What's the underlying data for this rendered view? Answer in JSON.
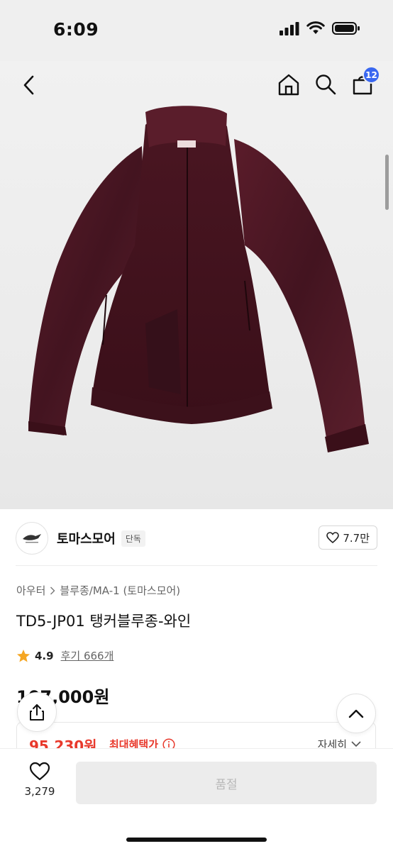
{
  "status_bar": {
    "time": "6:09"
  },
  "nav": {
    "cart_count": "12"
  },
  "seller": {
    "name": "토마스모어",
    "tag": "단독",
    "likes": "7.7만"
  },
  "breadcrumb": {
    "category": "아우터",
    "subcategory": "블루종/MA-1 (토마스모어)"
  },
  "product": {
    "title": "TD5-JP01 탱커블루종-와인"
  },
  "rating": {
    "score": "4.9",
    "review_label": "후기 666개"
  },
  "price": {
    "original": "107,000원"
  },
  "benefit": {
    "price": "95,230원",
    "label": "최대혜택가",
    "detail": "자세히"
  },
  "bottom": {
    "wish_count": "3,279",
    "cta": "품절"
  },
  "colors": {
    "accent": "#e8392c",
    "badge": "#3967f0",
    "star": "#f5a623",
    "jacket": "#4a1622"
  },
  "icons": [
    "back-icon",
    "home-icon",
    "search-icon",
    "cart-icon",
    "heart-icon",
    "star-icon",
    "info-icon",
    "chevron-down-icon",
    "share-icon",
    "chevron-up-icon"
  ]
}
